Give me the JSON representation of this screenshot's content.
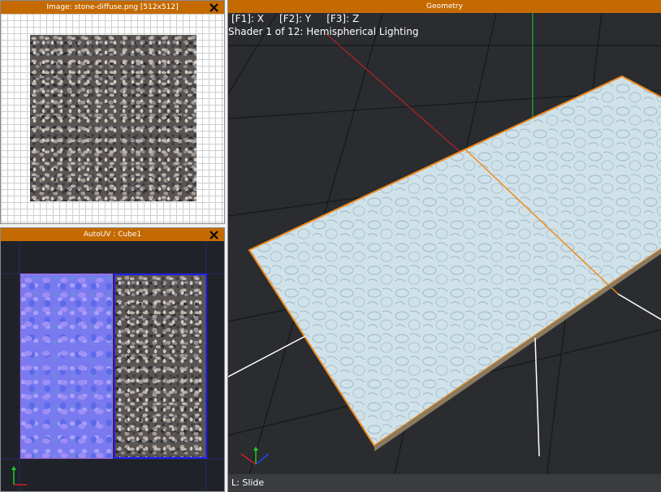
{
  "image_panel": {
    "title": "Image: stone-diffuse.png [512x512]",
    "close_icon": "close-icon"
  },
  "uv_panel": {
    "title": "AutoUV : Cube1",
    "close_icon": "close-icon"
  },
  "geometry_panel": {
    "title": "Geometry",
    "axis_keys": "[F1]: X     [F2]: Y     [F3]: Z",
    "shader_info": "Shader 1 of 12: Hemispherical Lighting",
    "status": "L: Slide"
  },
  "colors": {
    "title_bar": "#c46a00",
    "viewport_bg": "#2a2c30",
    "plane": "#cfe2ea",
    "selection_edge": "#f08a1a",
    "x_axis": "#cc2222",
    "y_axis": "#22cc22",
    "z_axis": "#2244ee",
    "uv_border": "#2222ff"
  }
}
